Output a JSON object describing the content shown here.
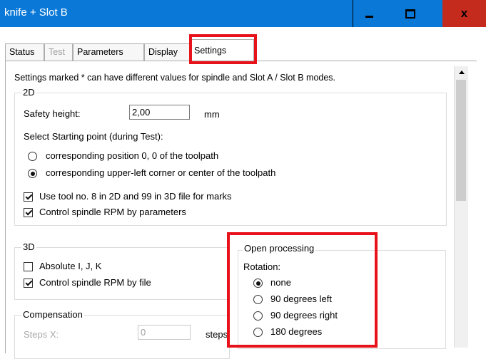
{
  "window": {
    "title": "knife + Slot B"
  },
  "tabs": [
    {
      "label": "Status"
    },
    {
      "label": "Test"
    },
    {
      "label": "Parameters"
    },
    {
      "label": "Display"
    },
    {
      "label": "Settings"
    }
  ],
  "note": "Settings marked * can have different values for spindle and Slot A / Slot B modes.",
  "group_2d": {
    "title": "2D",
    "safety_height_label": "Safety height:",
    "safety_height_value": "2,00",
    "safety_height_unit": "mm",
    "starting_point_label": "Select Starting point (during Test):",
    "radio_options": [
      {
        "label": "corresponding position 0, 0 of the toolpath",
        "checked": false
      },
      {
        "label": "corresponding upper-left corner or center of the toolpath",
        "checked": true
      }
    ],
    "checkboxes": [
      {
        "label": "Use tool no. 8 in 2D and 99 in 3D file for marks",
        "checked": true
      },
      {
        "label": "Control spindle RPM by parameters",
        "checked": true
      }
    ]
  },
  "group_3d": {
    "title": "3D",
    "checkboxes": [
      {
        "label": "Absolute I, J, K",
        "checked": false
      },
      {
        "label": "Control spindle RPM by file",
        "checked": true
      }
    ]
  },
  "group_compensation": {
    "title": "Compensation",
    "steps_x_label": "Steps X:",
    "steps_x_value": "0",
    "steps_unit": "steps"
  },
  "group_open_processing": {
    "title": "Open processing",
    "rotation_label": "Rotation:",
    "options": [
      {
        "label": "none",
        "checked": true
      },
      {
        "label": "90 degrees left",
        "checked": false
      },
      {
        "label": "90 degrees right",
        "checked": false
      },
      {
        "label": "180 degrees",
        "checked": false
      }
    ]
  },
  "colors": {
    "titlebar": "#0a78d7",
    "close_button": "#c42b1c",
    "highlight": "#e8121a"
  }
}
